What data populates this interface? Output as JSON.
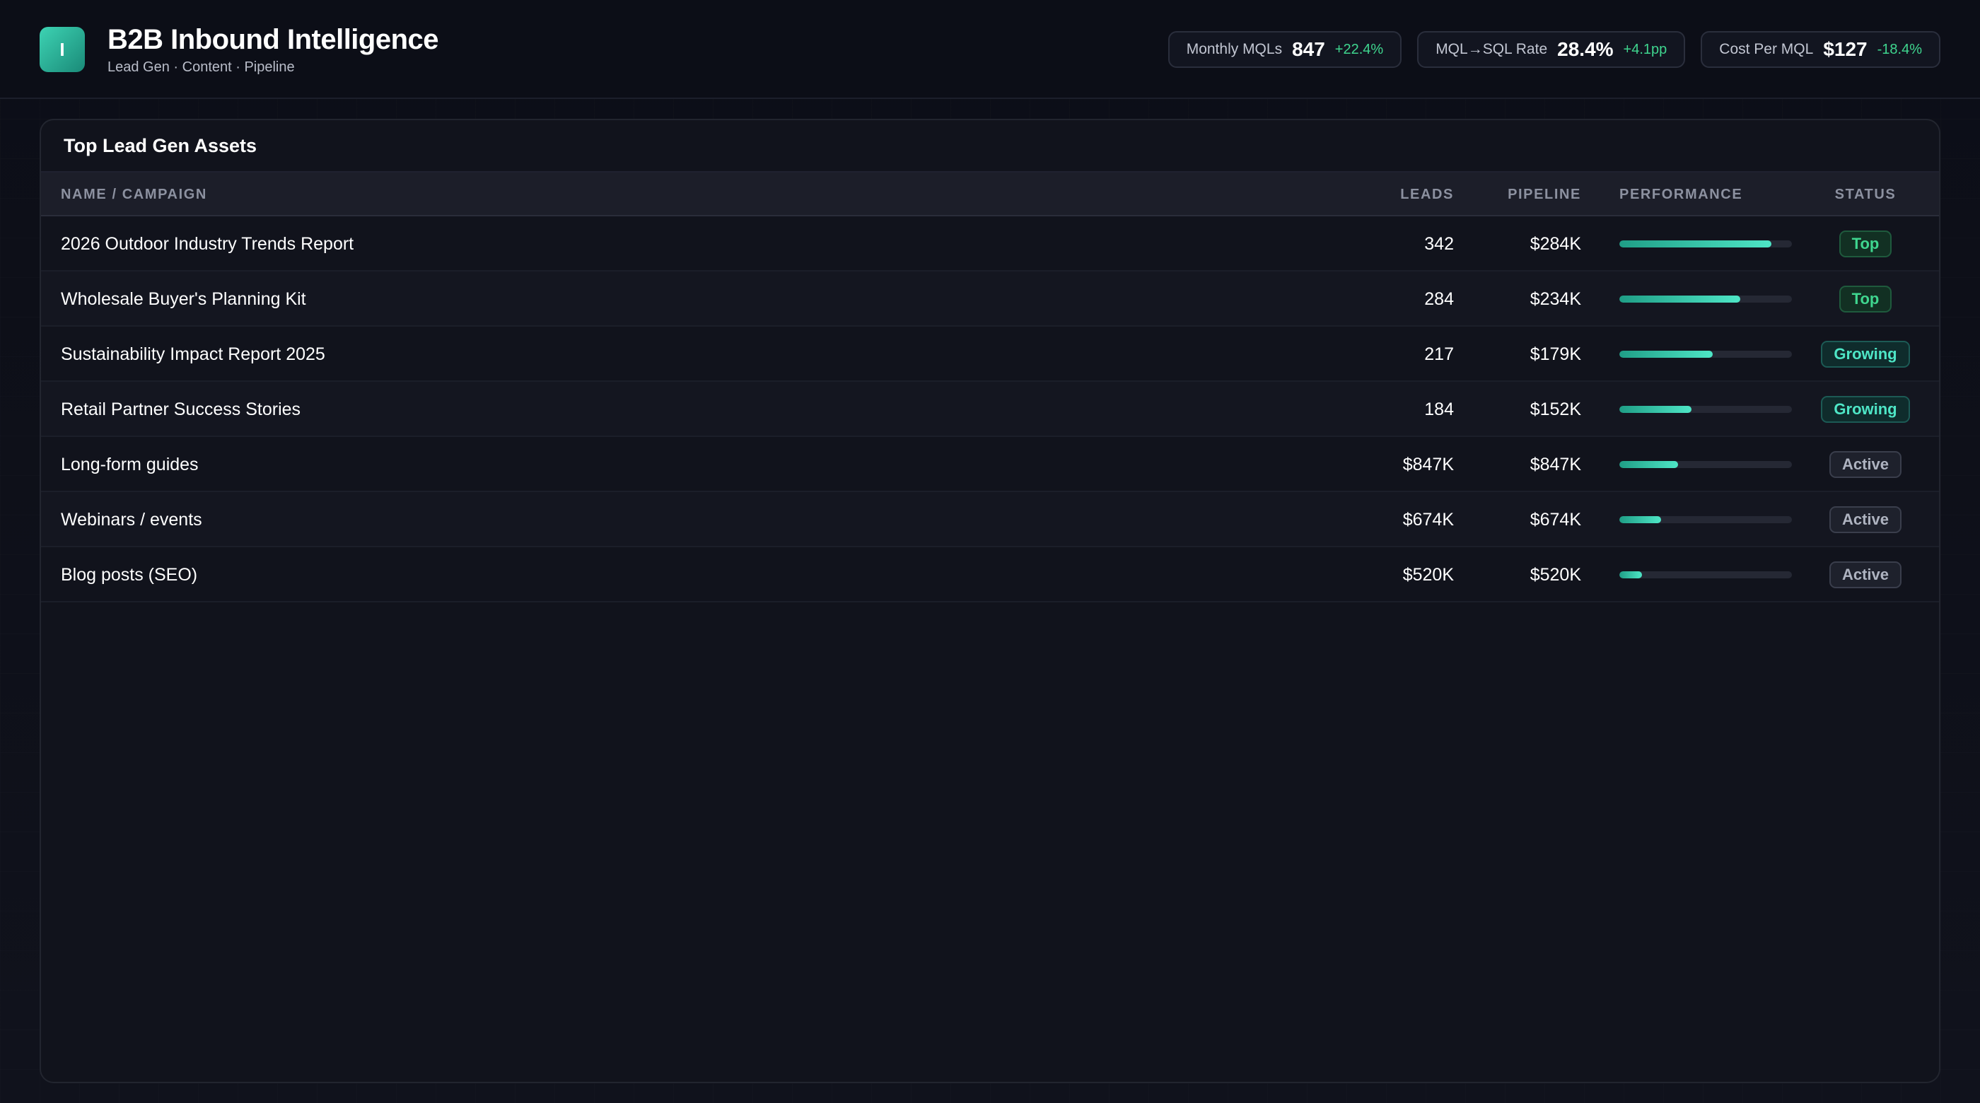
{
  "header": {
    "logo_letter": "I",
    "title": "B2B Inbound Intelligence",
    "subtitle": "Lead Gen · Content · Pipeline",
    "kpis": [
      {
        "label": "Monthly MQLs",
        "value": "847",
        "delta": "+22.4%"
      },
      {
        "label": "MQL→SQL Rate",
        "value": "28.4%",
        "delta": "+4.1pp"
      },
      {
        "label": "Cost Per MQL",
        "value": "$127",
        "delta": "-18.4%"
      }
    ]
  },
  "panel": {
    "title": "Top Lead Gen Assets",
    "columns": {
      "name": "NAME / CAMPAIGN",
      "leads": "LEADS",
      "pipeline": "PIPELINE",
      "performance": "PERFORMANCE",
      "status": "STATUS"
    },
    "rows": [
      {
        "name": "2026 Outdoor Industry Trends Report",
        "leads": "342",
        "pipeline": "$284K",
        "performance": 0.88,
        "status": "Top",
        "status_kind": "top"
      },
      {
        "name": "Wholesale Buyer's Planning Kit",
        "leads": "284",
        "pipeline": "$234K",
        "performance": 0.7,
        "status": "Top",
        "status_kind": "top"
      },
      {
        "name": "Sustainability Impact Report 2025",
        "leads": "217",
        "pipeline": "$179K",
        "performance": 0.54,
        "status": "Growing",
        "status_kind": "growing"
      },
      {
        "name": "Retail Partner Success Stories",
        "leads": "184",
        "pipeline": "$152K",
        "performance": 0.42,
        "status": "Growing",
        "status_kind": "growing"
      },
      {
        "name": "Long-form guides",
        "leads": "$847K",
        "pipeline": "$847K",
        "performance": 0.34,
        "status": "Active",
        "status_kind": "active"
      },
      {
        "name": "Webinars / events",
        "leads": "$674K",
        "pipeline": "$674K",
        "performance": 0.24,
        "status": "Active",
        "status_kind": "active"
      },
      {
        "name": "Blog posts (SEO)",
        "leads": "$520K",
        "pipeline": "$520K",
        "performance": 0.13,
        "status": "Active",
        "status_kind": "active"
      }
    ]
  },
  "colors": {
    "accent": "#3dd3b3",
    "positive": "#3fd68f",
    "background": "#0d0f18"
  }
}
